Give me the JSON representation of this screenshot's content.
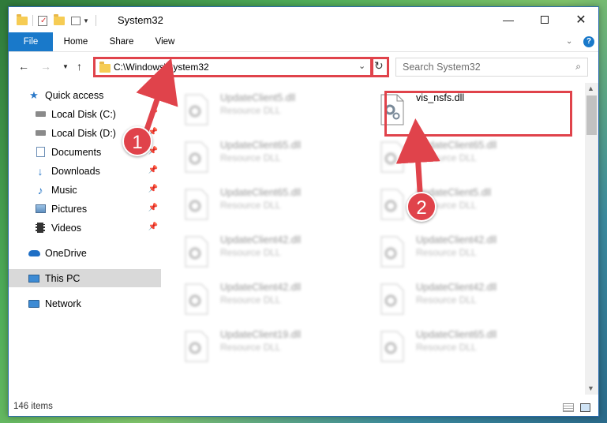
{
  "window": {
    "title": "System32"
  },
  "ribbon": {
    "tabs": [
      "File",
      "Home",
      "Share",
      "View"
    ]
  },
  "address": {
    "path": "C:\\Windows\\System32"
  },
  "search": {
    "placeholder": "Search System32"
  },
  "sidebar": {
    "items": [
      {
        "label": "Quick access",
        "icon": "star-icon",
        "pinned": false
      },
      {
        "label": "Local Disk (C:)",
        "icon": "drive-icon",
        "pinned": true
      },
      {
        "label": "Local Disk (D:)",
        "icon": "drive-icon",
        "pinned": true
      },
      {
        "label": "Documents",
        "icon": "documents-icon",
        "pinned": true
      },
      {
        "label": "Downloads",
        "icon": "download-icon",
        "pinned": true
      },
      {
        "label": "Music",
        "icon": "music-icon",
        "pinned": true
      },
      {
        "label": "Pictures",
        "icon": "pictures-icon",
        "pinned": true
      },
      {
        "label": "Videos",
        "icon": "video-icon",
        "pinned": true
      },
      {
        "label": "OneDrive",
        "icon": "cloud-icon",
        "pinned": false
      },
      {
        "label": "This PC",
        "icon": "computer-icon",
        "pinned": false,
        "selected": true
      },
      {
        "label": "Network",
        "icon": "network-icon",
        "pinned": false
      }
    ]
  },
  "files": {
    "left": [
      {
        "name": "UpdateClient5.dll",
        "type": "Resource DLL"
      },
      {
        "name": "UpdateClient65.dll",
        "type": "Resource DLL"
      },
      {
        "name": "UpdateClient65.dll",
        "type": "Resource DLL"
      },
      {
        "name": "UpdateClient42.dll",
        "type": "Resource DLL"
      },
      {
        "name": "UpdateClient42.dll",
        "type": "Resource DLL"
      },
      {
        "name": "UpdateClient19.dll",
        "type": "Resource DLL"
      }
    ],
    "right": [
      {
        "name": "vis_nsfs.dll",
        "type": "",
        "highlighted": true
      },
      {
        "name": "UpdateClient65.dll",
        "type": "Resource DLL"
      },
      {
        "name": "UpdateClient5.dll",
        "type": "Resource DLL"
      },
      {
        "name": "UpdateClient42.dll",
        "type": "Resource DLL"
      },
      {
        "name": "UpdateClient42.dll",
        "type": "Resource DLL"
      },
      {
        "name": "UpdateClient65.dll",
        "type": "Resource DLL"
      }
    ]
  },
  "status": {
    "count": "146 items"
  },
  "callouts": {
    "one": "1",
    "two": "2",
    "color": "#e0434b"
  },
  "colors": {
    "accent": "#1979ca",
    "highlight": "#e0434b"
  }
}
